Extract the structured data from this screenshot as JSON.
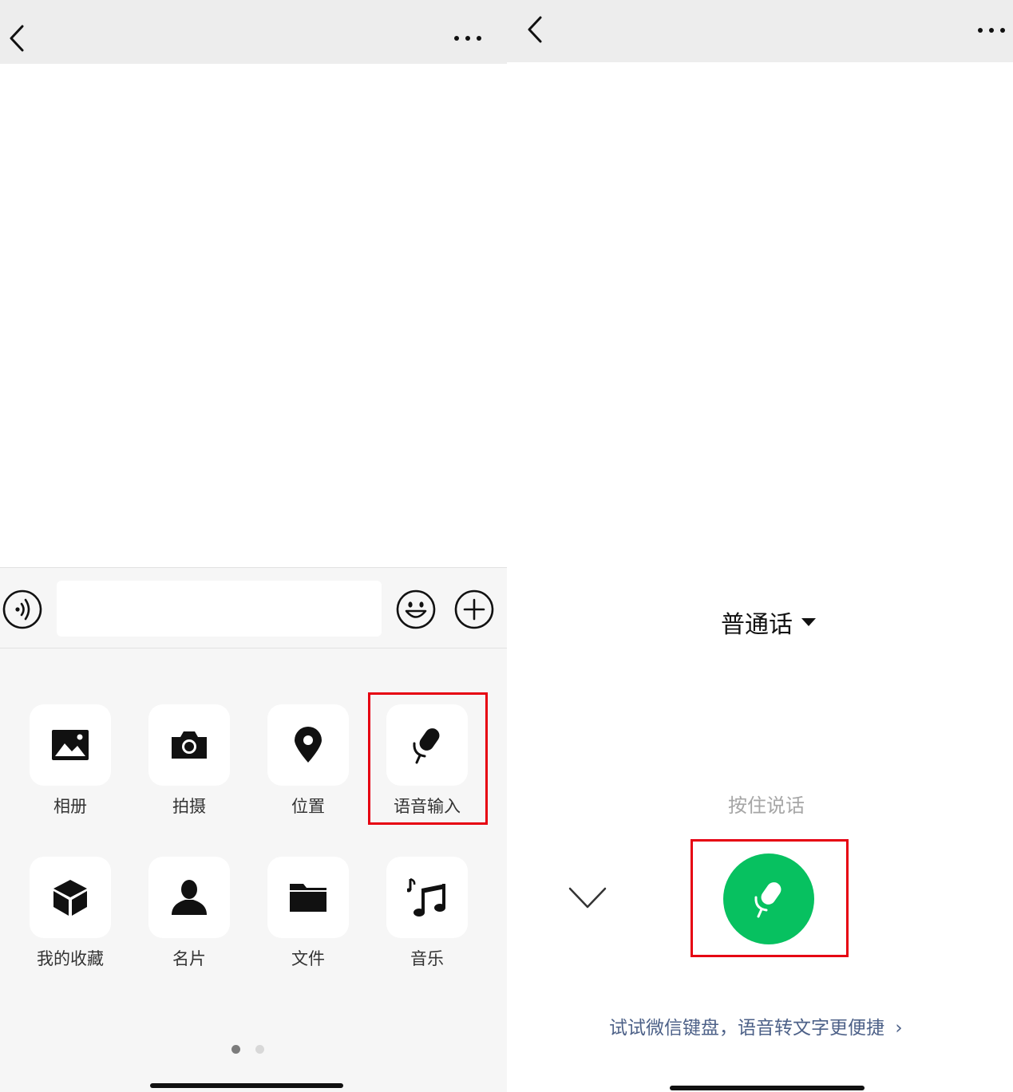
{
  "left_screen": {
    "navbar": {
      "back_icon": "chevron-left-icon",
      "more_icon": "more-horizontal-icon"
    },
    "input_bar": {
      "voice_icon": "voice-mode-icon",
      "text_value": "",
      "emoji_icon": "emoji-icon",
      "plus_icon": "plus-circle-icon"
    },
    "actions": [
      {
        "label": "相册",
        "icon": "photo-album-icon"
      },
      {
        "label": "拍摄",
        "icon": "camera-icon"
      },
      {
        "label": "位置",
        "icon": "location-pin-icon"
      },
      {
        "label": "语音输入",
        "icon": "microphone-icon"
      },
      {
        "label": "我的收藏",
        "icon": "favorites-cube-icon"
      },
      {
        "label": "名片",
        "icon": "contact-card-icon"
      },
      {
        "label": "文件",
        "icon": "folder-icon"
      },
      {
        "label": "音乐",
        "icon": "music-note-icon"
      }
    ],
    "pagination": {
      "pages": 2,
      "active_page": 1
    }
  },
  "right_screen": {
    "navbar": {
      "back_icon": "chevron-left-icon",
      "more_icon": "more-horizontal-icon"
    },
    "language": "普通话",
    "hold_hint": "按住说话",
    "mic_icon": "microphone-icon",
    "collapse_icon": "chevron-down-icon",
    "tip": "试试微信键盘，语音转文字更便捷",
    "tip_arrow": "›"
  },
  "colors": {
    "accent_green": "#07c160",
    "highlight_red": "#e60012",
    "navbar_bg": "#ededed",
    "panel_bg": "#f6f6f6",
    "link_blue": "#4d6188"
  }
}
